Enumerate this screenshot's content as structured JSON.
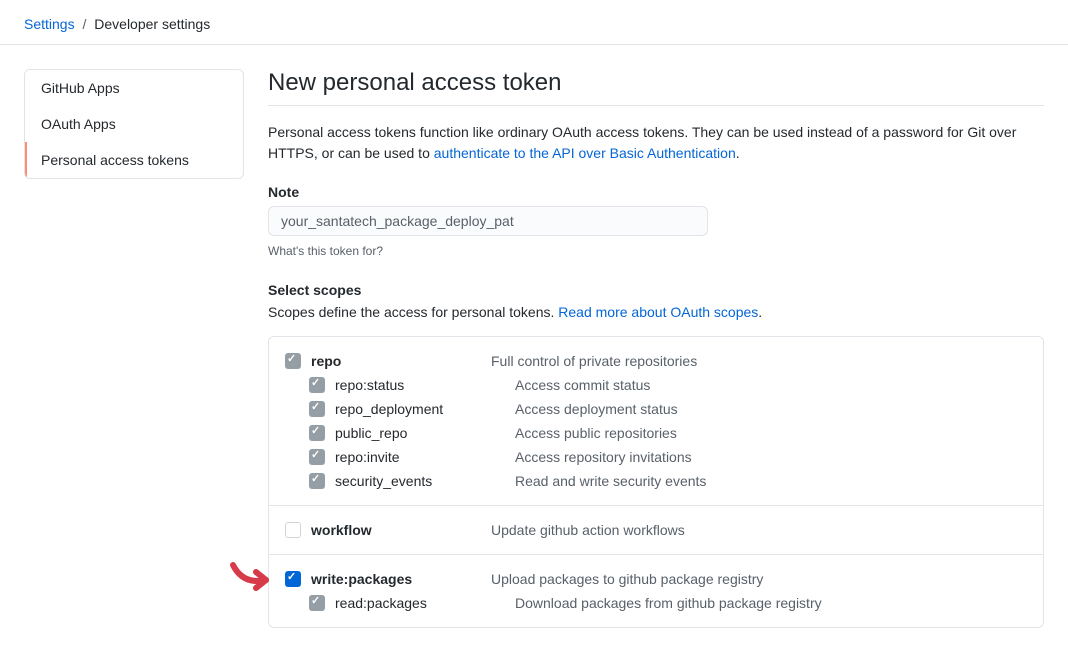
{
  "breadcrumb": {
    "root": "Settings",
    "current": "Developer settings"
  },
  "sidebar": {
    "items": [
      {
        "label": "GitHub Apps"
      },
      {
        "label": "OAuth Apps"
      },
      {
        "label": "Personal access tokens"
      }
    ]
  },
  "page": {
    "title": "New personal access token",
    "intro_prefix": "Personal access tokens function like ordinary OAuth access tokens. They can be used instead of a password for Git over HTTPS, or can be used to ",
    "intro_link": "authenticate to the API over Basic Authentication",
    "intro_suffix": "."
  },
  "note": {
    "label": "Note",
    "value": "your_santatech_package_deploy_pat",
    "hint": "What's this token for?"
  },
  "scopes": {
    "heading": "Select scopes",
    "intro_prefix": "Scopes define the access for personal tokens. ",
    "intro_link": "Read more about OAuth scopes",
    "intro_suffix": "."
  },
  "scope_groups": [
    {
      "parent": {
        "name": "repo",
        "desc": "Full control of private repositories",
        "state": "disabled",
        "bold": true
      },
      "children": [
        {
          "name": "repo:status",
          "desc": "Access commit status",
          "state": "disabled"
        },
        {
          "name": "repo_deployment",
          "desc": "Access deployment status",
          "state": "disabled"
        },
        {
          "name": "public_repo",
          "desc": "Access public repositories",
          "state": "disabled"
        },
        {
          "name": "repo:invite",
          "desc": "Access repository invitations",
          "state": "disabled"
        },
        {
          "name": "security_events",
          "desc": "Read and write security events",
          "state": "disabled"
        }
      ]
    },
    {
      "parent": {
        "name": "workflow",
        "desc": "Update github action workflows",
        "state": "unchecked",
        "bold": true
      },
      "children": []
    },
    {
      "parent": {
        "name": "write:packages",
        "desc": "Upload packages to github package registry",
        "state": "checked",
        "bold": true
      },
      "children": [
        {
          "name": "read:packages",
          "desc": "Download packages from github package registry",
          "state": "disabled"
        }
      ]
    }
  ]
}
